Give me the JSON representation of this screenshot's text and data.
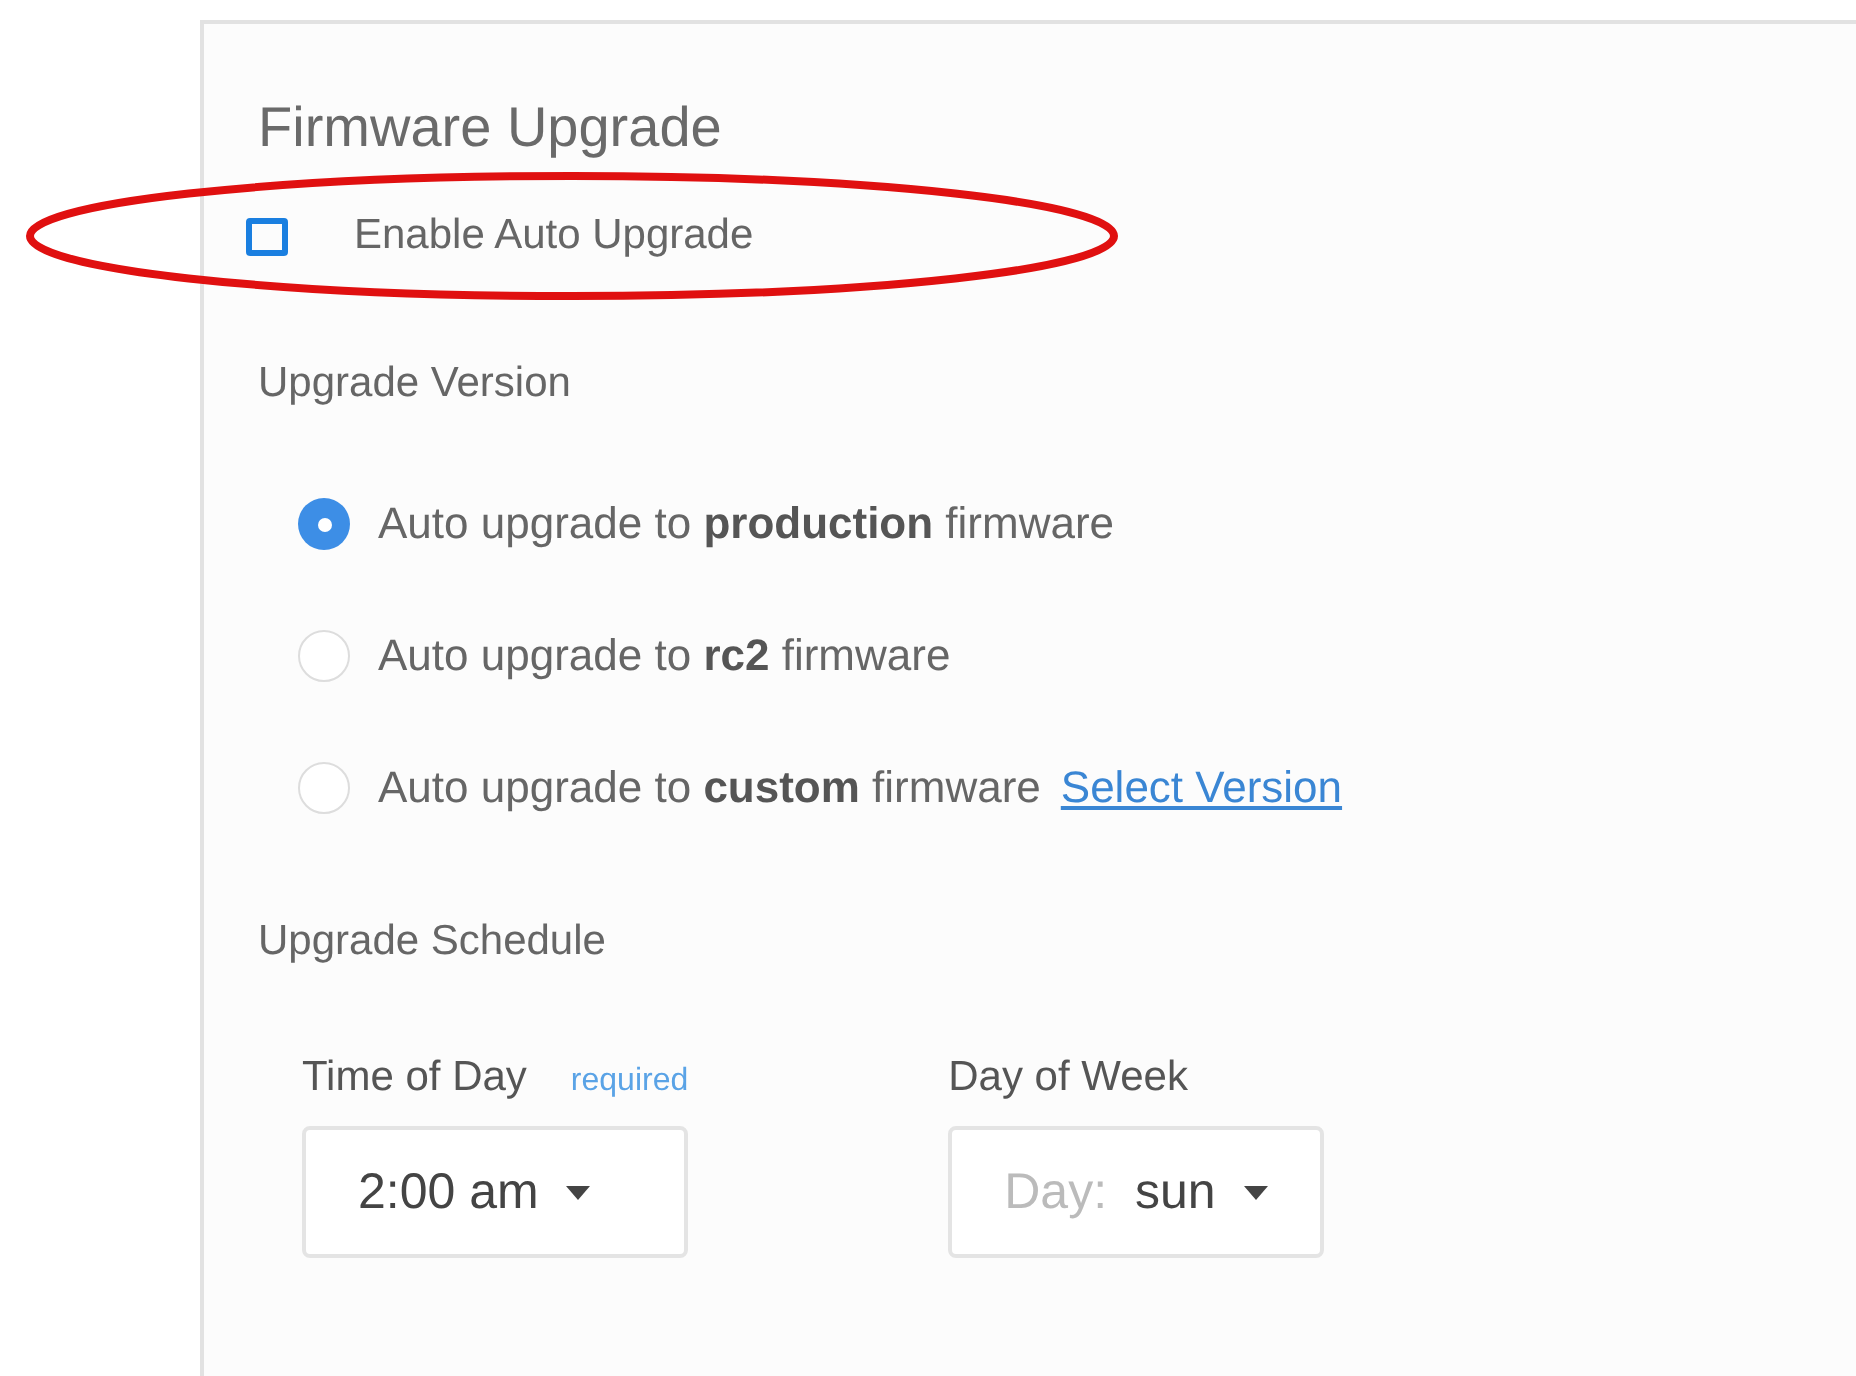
{
  "panel": {
    "title": "Firmware Upgrade",
    "auto_upgrade": {
      "label": "Enable Auto Upgrade",
      "checked": false,
      "highlighted": true
    },
    "version_heading": "Upgrade Version",
    "versions": [
      {
        "label": "Auto upgrade to **production** firmware",
        "selected": true
      },
      {
        "label": "Auto upgrade to **rc2** firmware",
        "selected": false
      },
      {
        "label": "Auto upgrade to **custom** firmware",
        "selected": false,
        "link": "Select Version"
      }
    ],
    "schedule_heading": "Upgrade Schedule",
    "fields": [
      {
        "label": "Time of Day",
        "hint": "required",
        "value": "2:00 am"
      },
      {
        "label": "Day of Week",
        "prefix": "Day:",
        "value": "sun"
      }
    ]
  }
}
